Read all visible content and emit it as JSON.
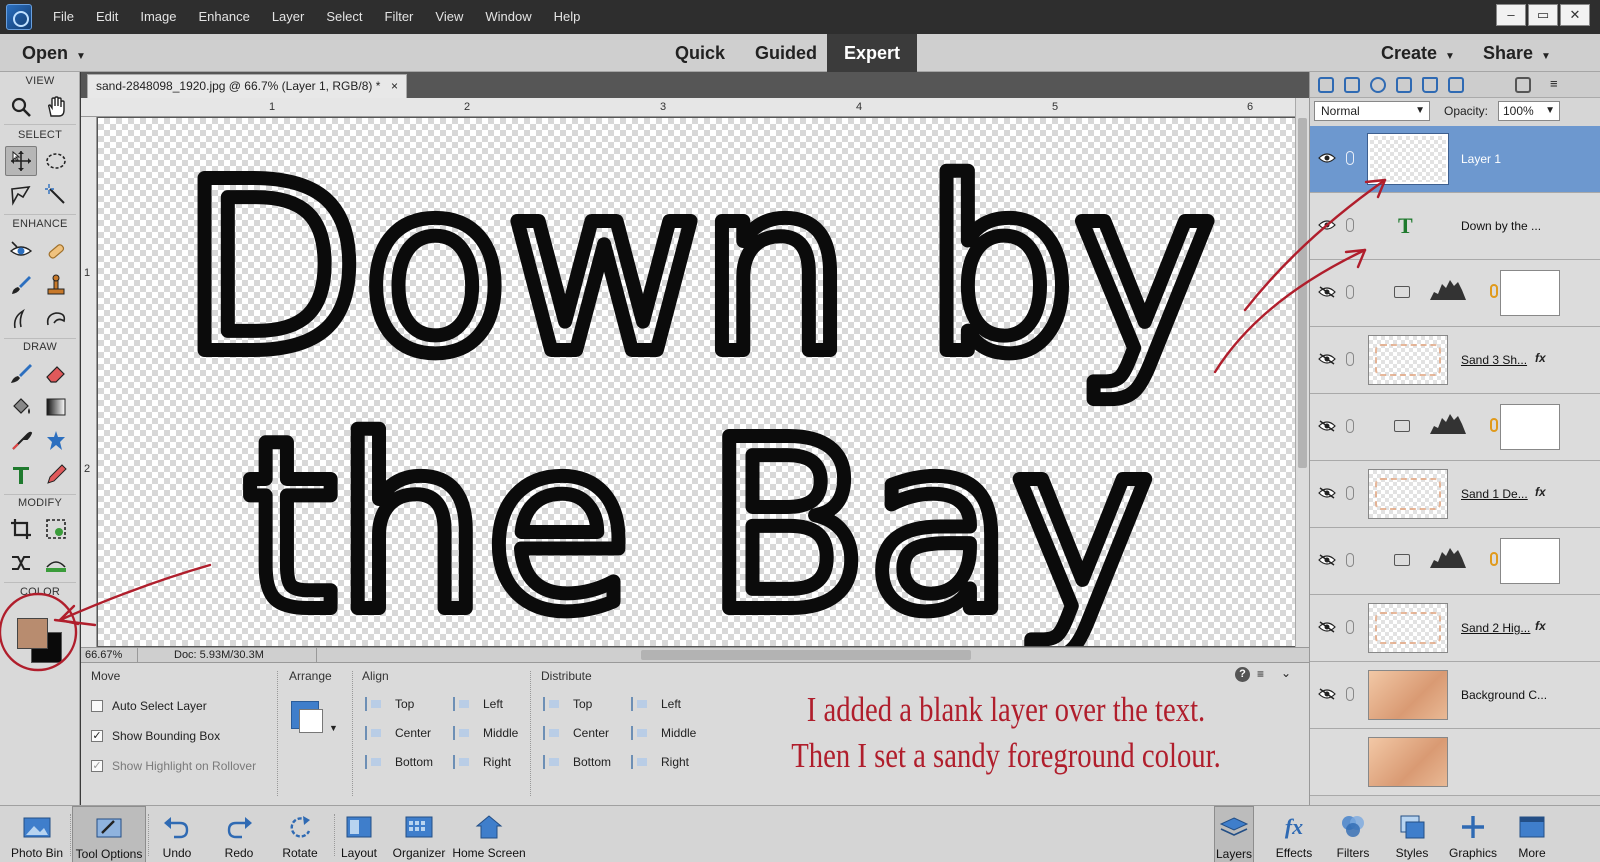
{
  "menu": [
    "File",
    "Edit",
    "Image",
    "Enhance",
    "Layer",
    "Select",
    "Filter",
    "View",
    "Window",
    "Help"
  ],
  "window_controls": [
    "–",
    "▭",
    "✕"
  ],
  "modebar": {
    "open": "Open",
    "quick": "Quick",
    "guided": "Guided",
    "expert": "Expert",
    "create": "Create",
    "share": "Share"
  },
  "document": {
    "tab_title": "sand-2848098_1920.jpg @ 66.7% (Layer 1, RGB/8) *",
    "close": "×",
    "zoom": "66.67%",
    "doc_info": "Doc: 5.93M/30.3M",
    "ruler_top": [
      "1",
      "2",
      "3",
      "4",
      "5",
      "6"
    ],
    "ruler_left": [
      "1",
      "2"
    ],
    "canvas_text_line1": "Down by",
    "canvas_text_line2": "the Bay"
  },
  "toolbox": {
    "sections": {
      "view": "VIEW",
      "select": "SELECT",
      "enhance": "ENHANCE",
      "draw": "DRAW",
      "modify": "MODIFY",
      "color": "COLOR"
    },
    "foreground_color": "#b88c6f",
    "background_color": "#0a0a0a"
  },
  "options": {
    "move": "Move",
    "auto_select": "Auto Select Layer",
    "show_bbox": "Show Bounding Box",
    "show_highlight": "Show Highlight on Rollover",
    "arrange": "Arrange",
    "align": "Align",
    "align_items": [
      "Top",
      "Center",
      "Bottom",
      "Left",
      "Middle",
      "Right"
    ],
    "distribute": "Distribute",
    "distribute_items": [
      "Top",
      "Center",
      "Bottom",
      "Left",
      "Middle",
      "Right"
    ],
    "caption_line1": "I added a blank layer over the text.",
    "caption_line2": "Then I set a sandy foreground colour."
  },
  "layers_panel": {
    "blend_mode": "Normal",
    "opacity_label": "Opacity:",
    "opacity": "100%",
    "layers": [
      {
        "name": "Layer 1",
        "selected": true,
        "visible": true
      },
      {
        "name": "Down by the ...",
        "type": "text",
        "visible": true
      },
      {
        "name": "",
        "type": "adjustment",
        "visible": false
      },
      {
        "name": "Sand 3 Sh...",
        "fx": "fx",
        "visible": false
      },
      {
        "name": "",
        "type": "adjustment",
        "visible": false
      },
      {
        "name": "Sand 1 De...",
        "fx": "fx",
        "visible": false
      },
      {
        "name": "",
        "type": "adjustment",
        "visible": false
      },
      {
        "name": "Sand 2 Hig...",
        "fx": "fx",
        "visible": false
      },
      {
        "name": "Background C...",
        "visible": false
      }
    ]
  },
  "bottombar": {
    "photo_bin": "Photo Bin",
    "tool_options": "Tool Options",
    "undo": "Undo",
    "redo": "Redo",
    "rotate": "Rotate",
    "layout": "Layout",
    "organizer": "Organizer",
    "home_screen": "Home Screen",
    "layers": "Layers",
    "effects": "Effects",
    "filters": "Filters",
    "styles": "Styles",
    "graphics": "Graphics",
    "more": "More"
  },
  "colors": {
    "accent": "#6d98cf",
    "annotation": "#b01e2c"
  }
}
